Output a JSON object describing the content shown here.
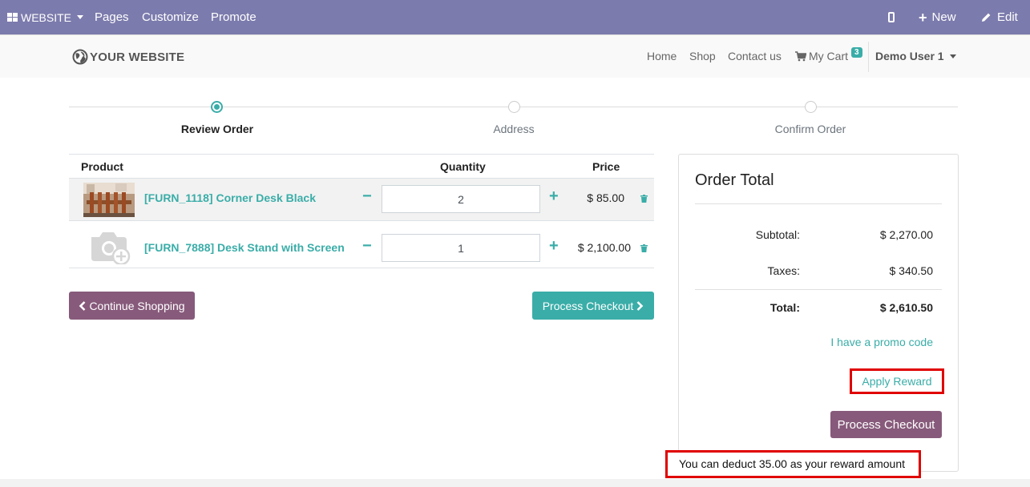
{
  "topbar": {
    "website_label": "WEBSITE",
    "pages_label": "Pages",
    "customize_label": "Customize",
    "promote_label": "Promote",
    "new_label": "New",
    "edit_label": "Edit",
    "background_color": "#7c7bad"
  },
  "header": {
    "logo_text": "YOUR WEBSITE",
    "nav": {
      "home": "Home",
      "shop": "Shop",
      "contact": "Contact us",
      "cart": "My Cart",
      "cart_count": "3",
      "user": "Demo User 1"
    }
  },
  "wizard": {
    "steps": [
      {
        "label": "Review Order",
        "active": true
      },
      {
        "label": "Address",
        "active": false
      },
      {
        "label": "Confirm Order",
        "active": false
      }
    ]
  },
  "cart": {
    "headers": {
      "product": "Product",
      "quantity": "Quantity",
      "price": "Price"
    },
    "rows": [
      {
        "name": "[FURN_1118] Corner Desk Black",
        "quantity": "2",
        "price": "$ 85.00",
        "image_icon": "product-photo-icon"
      },
      {
        "name": "[FURN_7888] Desk Stand with Screen",
        "quantity": "1",
        "price": "$ 2,100.00",
        "image_icon": "camera-placeholder-icon"
      }
    ],
    "continue_label": "Continue Shopping",
    "process_label": "Process Checkout"
  },
  "order_total": {
    "title": "Order Total",
    "subtotal_label": "Subtotal:",
    "subtotal_value": "$ 2,270.00",
    "taxes_label": "Taxes:",
    "taxes_value": "$ 340.50",
    "total_label": "Total:",
    "total_value": "$ 2,610.50",
    "promo_label": "I have a promo code",
    "reward_label": "Apply Reward",
    "process_label": "Process Checkout",
    "reward_message": "You can deduct 35.00 as your reward amount"
  },
  "colors": {
    "accent": "#3aada8",
    "primary_button": "#875a7b",
    "highlight": "#e00000"
  }
}
